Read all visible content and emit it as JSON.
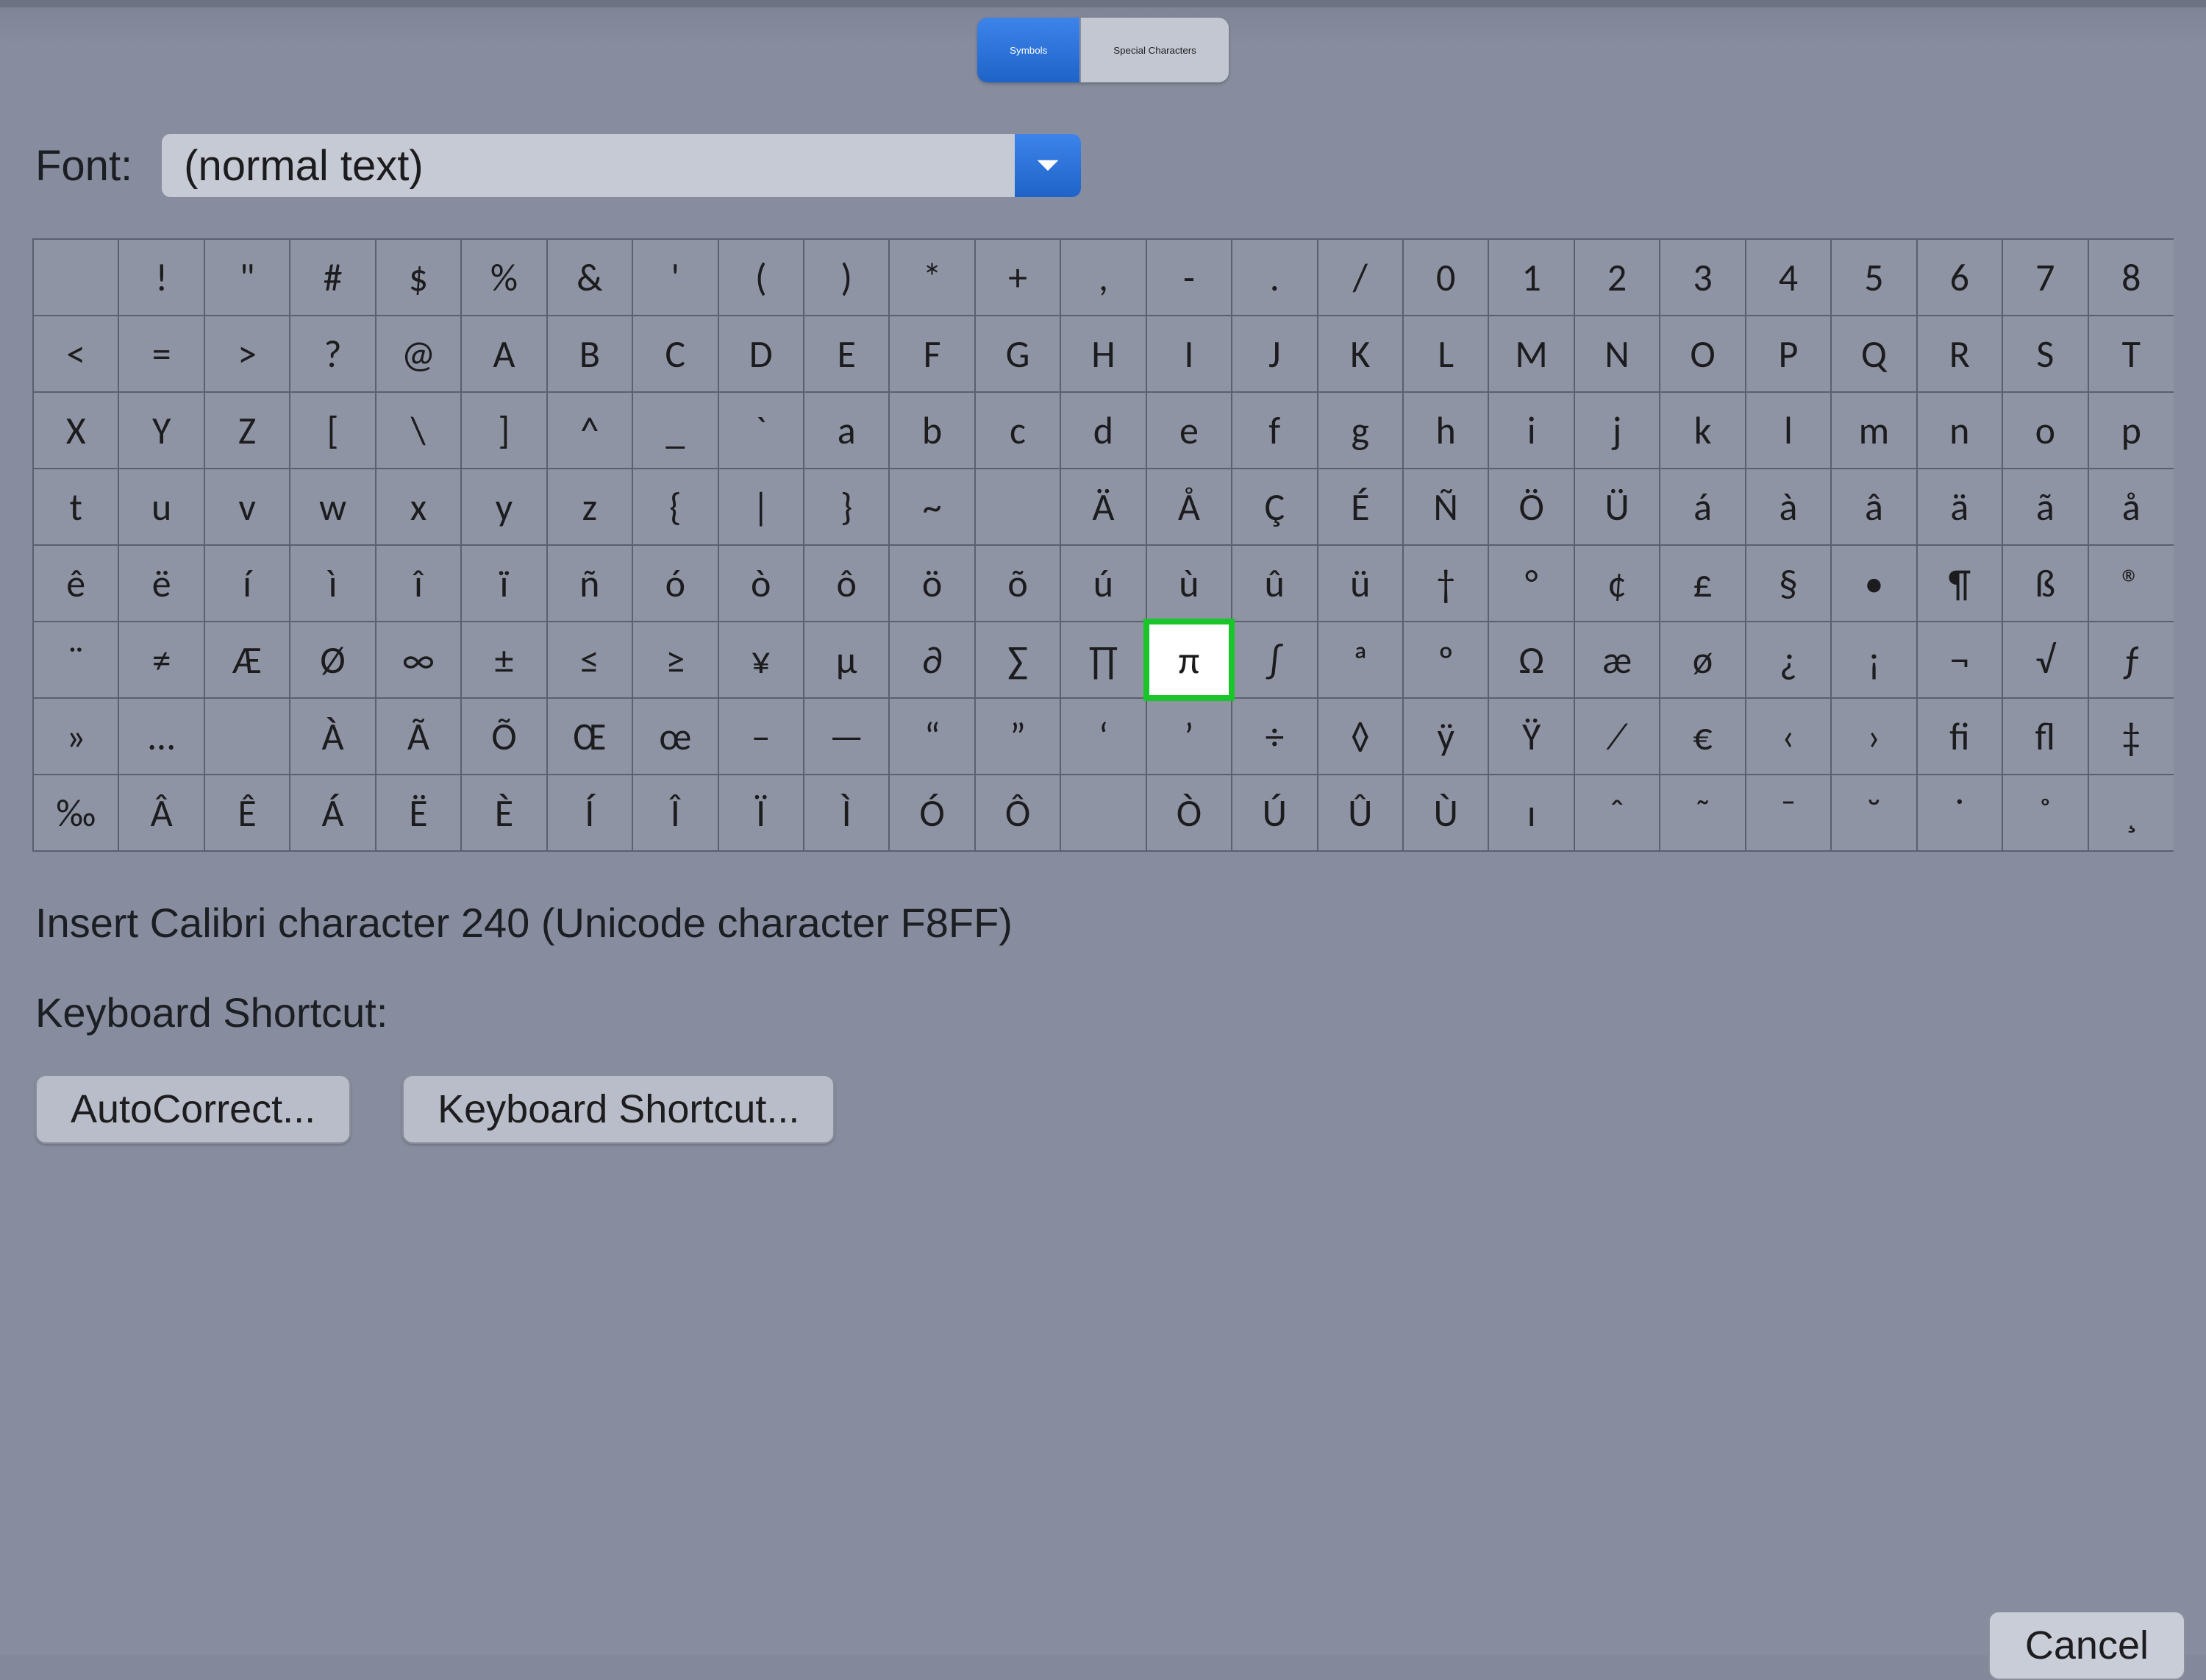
{
  "tabs": {
    "symbols": "Symbols",
    "special": "Special Characters"
  },
  "font": {
    "label": "Font:",
    "value": "(normal text)"
  },
  "grid": {
    "highlight": {
      "row": 5,
      "col": 13,
      "name": "pi"
    },
    "rows": [
      [
        "",
        "!",
        "\"",
        "#",
        "$",
        "%",
        "&",
        "'",
        "(",
        ")",
        "*",
        "+",
        ",",
        "-",
        ".",
        "/",
        "0",
        "1",
        "2",
        "3",
        "4",
        "5",
        "6",
        "7",
        "8"
      ],
      [
        "<",
        "=",
        ">",
        "?",
        "@",
        "A",
        "B",
        "C",
        "D",
        "E",
        "F",
        "G",
        "H",
        "I",
        "J",
        "K",
        "L",
        "M",
        "N",
        "O",
        "P",
        "Q",
        "R",
        "S",
        "T"
      ],
      [
        "X",
        "Y",
        "Z",
        "[",
        "\\",
        "]",
        "^",
        "_",
        "`",
        "a",
        "b",
        "c",
        "d",
        "e",
        "f",
        "g",
        "h",
        "i",
        "j",
        "k",
        "l",
        "m",
        "n",
        "o",
        "p"
      ],
      [
        "t",
        "u",
        "v",
        "w",
        "x",
        "y",
        "z",
        "{",
        "|",
        "}",
        "~",
        "",
        "Ä",
        "Å",
        "Ç",
        "É",
        "Ñ",
        "Ö",
        "Ü",
        "á",
        "à",
        "â",
        "ä",
        "ã",
        "å"
      ],
      [
        "ê",
        "ë",
        "í",
        "ì",
        "î",
        "ï",
        "ñ",
        "ó",
        "ò",
        "ô",
        "ö",
        "õ",
        "ú",
        "ù",
        "û",
        "ü",
        "†",
        "°",
        "¢",
        "£",
        "§",
        "•",
        "¶",
        "ß",
        "®"
      ],
      [
        "¨",
        "≠",
        "Æ",
        "Ø",
        "∞",
        "±",
        "≤",
        "≥",
        "¥",
        "µ",
        "∂",
        "∑",
        "∏",
        "π",
        "∫",
        "ª",
        "º",
        "Ω",
        "æ",
        "ø",
        "¿",
        "¡",
        "¬",
        "√",
        "ƒ"
      ],
      [
        "»",
        "…",
        "",
        "À",
        "Ã",
        "Õ",
        "Œ",
        "œ",
        "–",
        "—",
        "“",
        "”",
        "‘",
        "’",
        "÷",
        "◊",
        "ÿ",
        "Ÿ",
        "⁄",
        "€",
        "‹",
        "›",
        "ﬁ",
        "ﬂ",
        "‡"
      ],
      [
        "‰",
        "Â",
        "Ê",
        "Á",
        "Ë",
        "È",
        "Í",
        "Î",
        "Ï",
        "Ì",
        "Ó",
        "Ô",
        "",
        "Ò",
        "Ú",
        "Û",
        "Ù",
        "ı",
        "ˆ",
        "˜",
        "¯",
        "˘",
        "˙",
        "˚",
        "¸"
      ]
    ]
  },
  "info": {
    "desc": "Insert Calibri character 240  (Unicode character F8FF)",
    "shortcut_label": "Keyboard Shortcut:"
  },
  "buttons": {
    "autocorrect": "AutoCorrect...",
    "shortcut": "Keyboard Shortcut...",
    "cancel": "Cancel"
  }
}
